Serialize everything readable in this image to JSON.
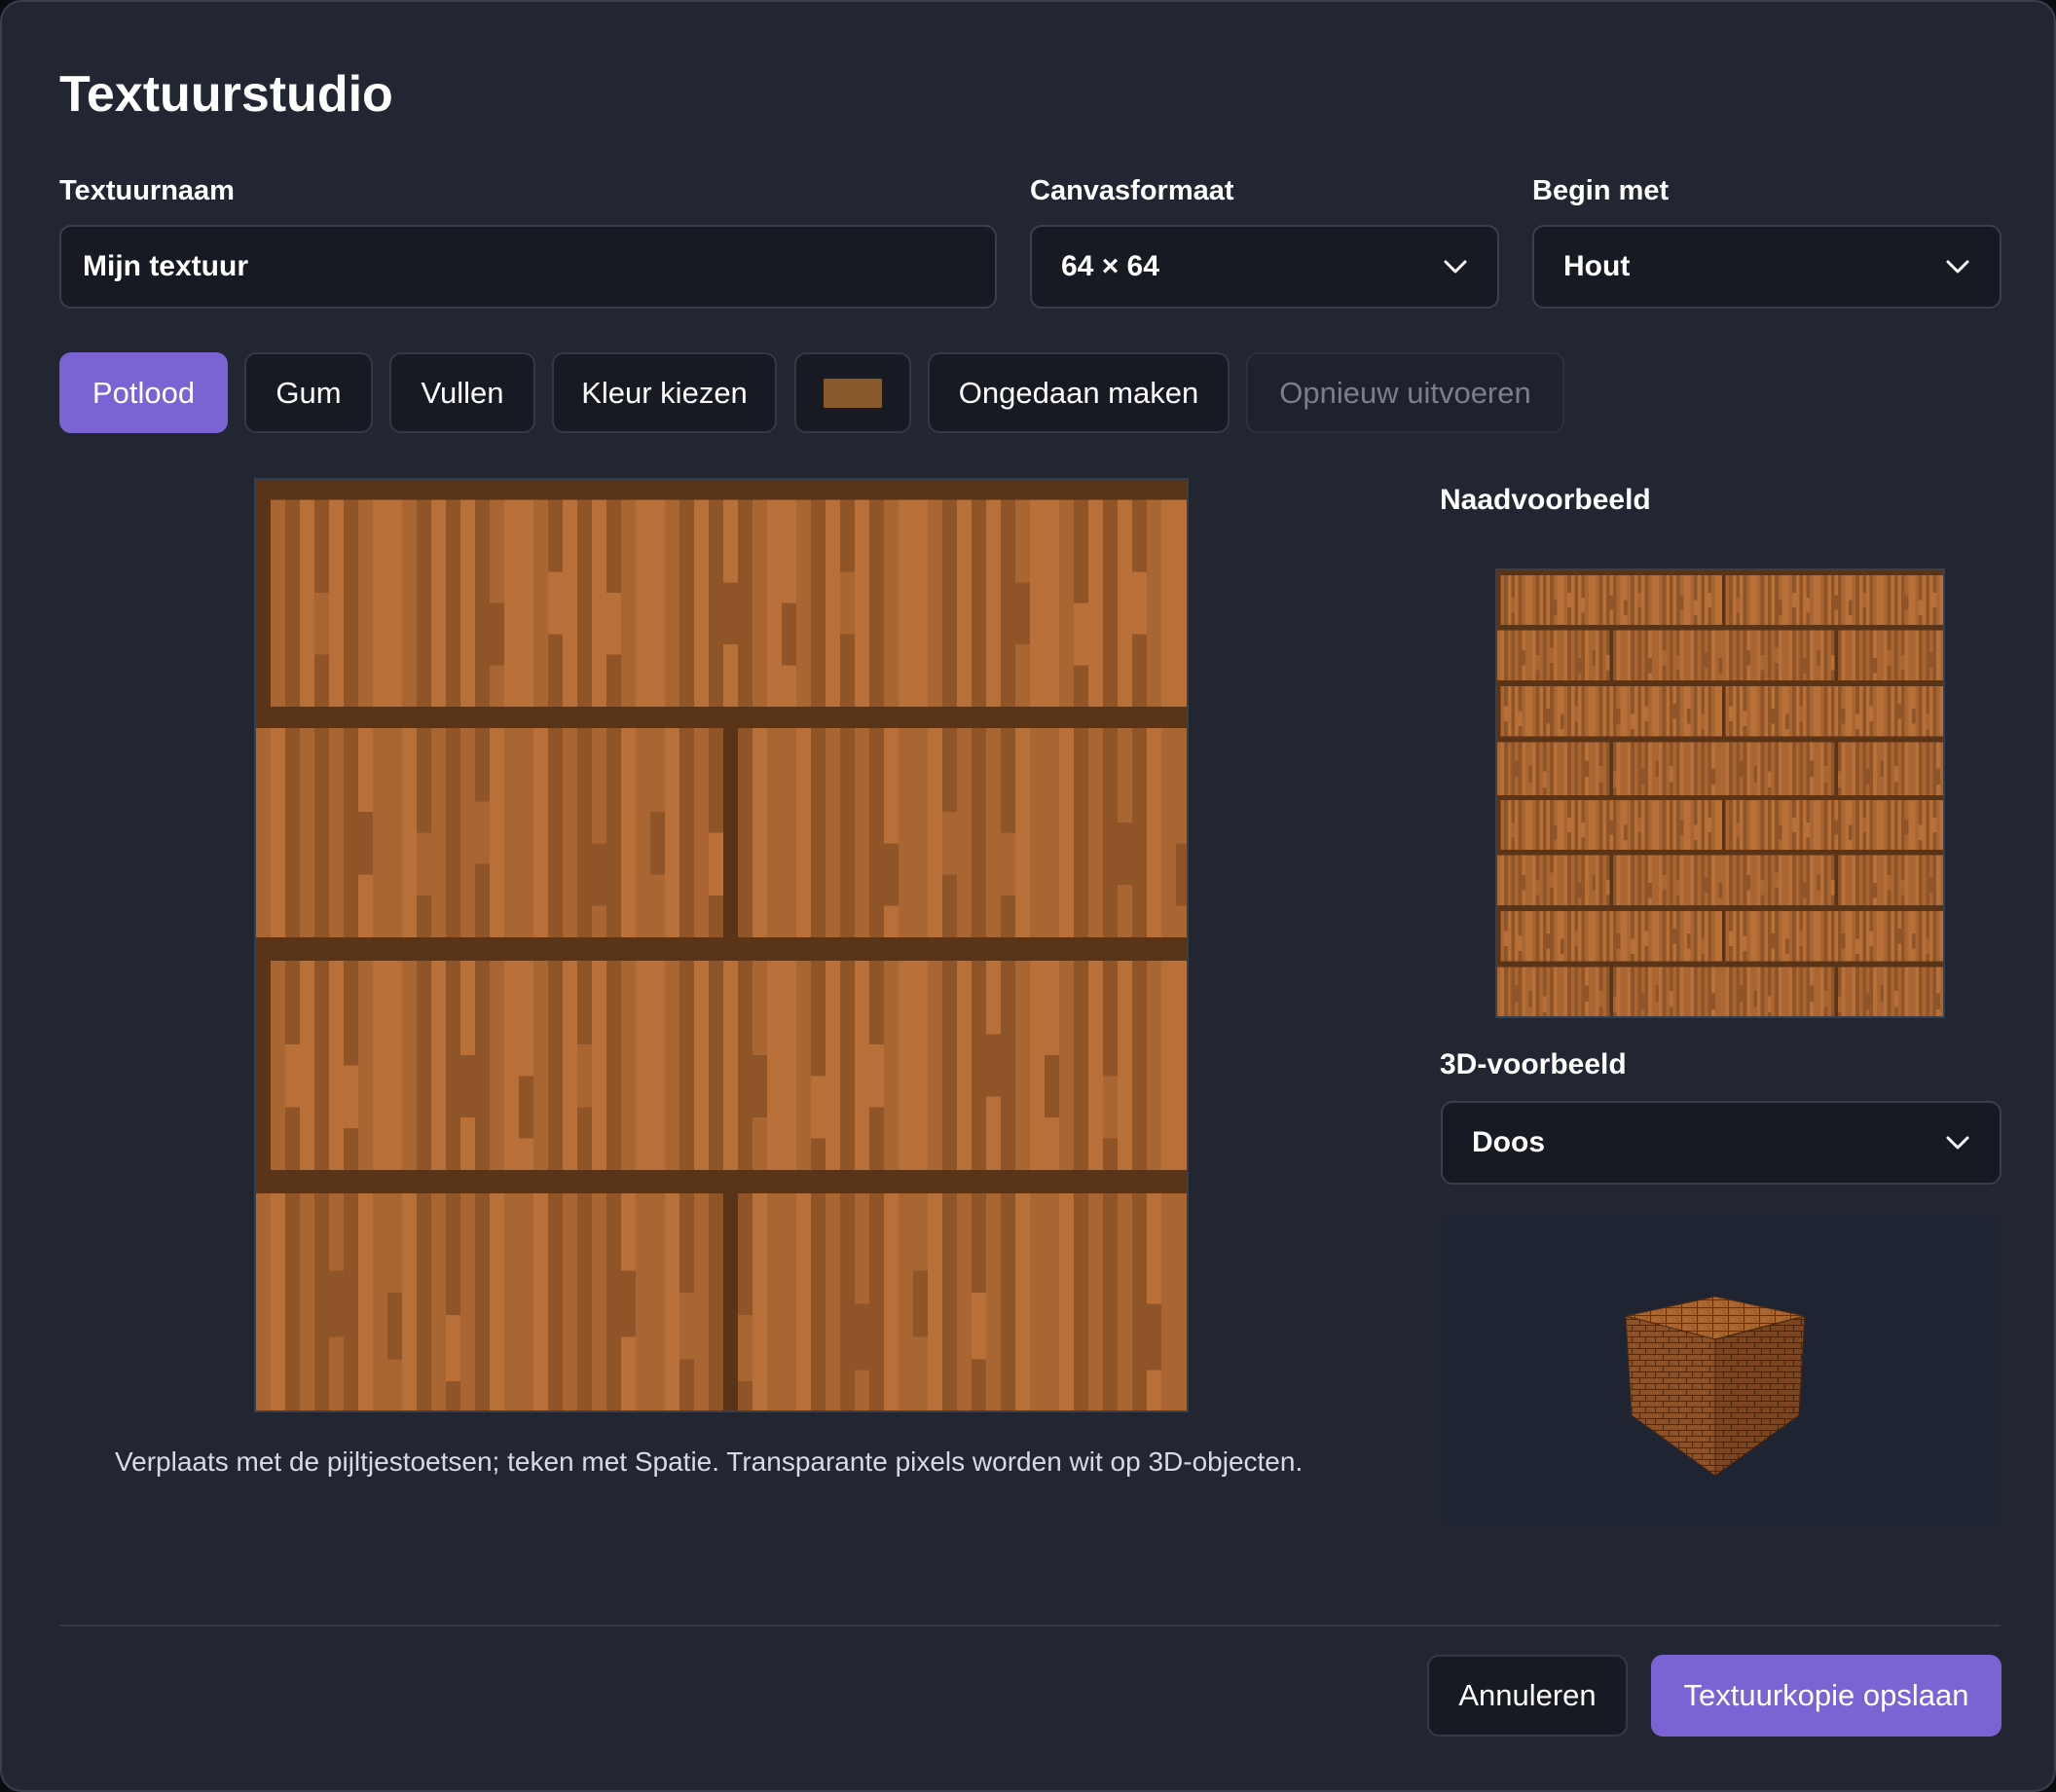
{
  "dialog": {
    "title": "Textuurstudio"
  },
  "fields": {
    "name_label": "Textuurnaam",
    "name_value": "Mijn textuur",
    "size_label": "Canvasformaat",
    "size_value": "64 × 64",
    "start_label": "Begin met",
    "start_value": "Hout"
  },
  "toolbar": {
    "pencil": "Potlood",
    "eraser": "Gum",
    "fill": "Vullen",
    "pick_color": "Kleur kiezen",
    "undo": "Ongedaan maken",
    "redo": "Opnieuw uitvoeren",
    "active_tool": "Potlood",
    "current_color": "#8b5a2b"
  },
  "canvas": {
    "hint": "Verplaats met de pijltjestoetsen; teken met Spatie. Transparante pixels worden wit op 3D-objecten."
  },
  "preview": {
    "seamless_label": "Naadvoorbeeld",
    "label_3d": "3D-voorbeeld",
    "shape_value": "Doos"
  },
  "footer": {
    "cancel": "Annuleren",
    "save": "Textuurkopie opslaan"
  },
  "colors": {
    "accent": "#7b63d4",
    "wood_light": "#b86f38",
    "wood_mid": "#a96532",
    "wood_dark": "#8f5428",
    "mortar": "#5a3418"
  }
}
